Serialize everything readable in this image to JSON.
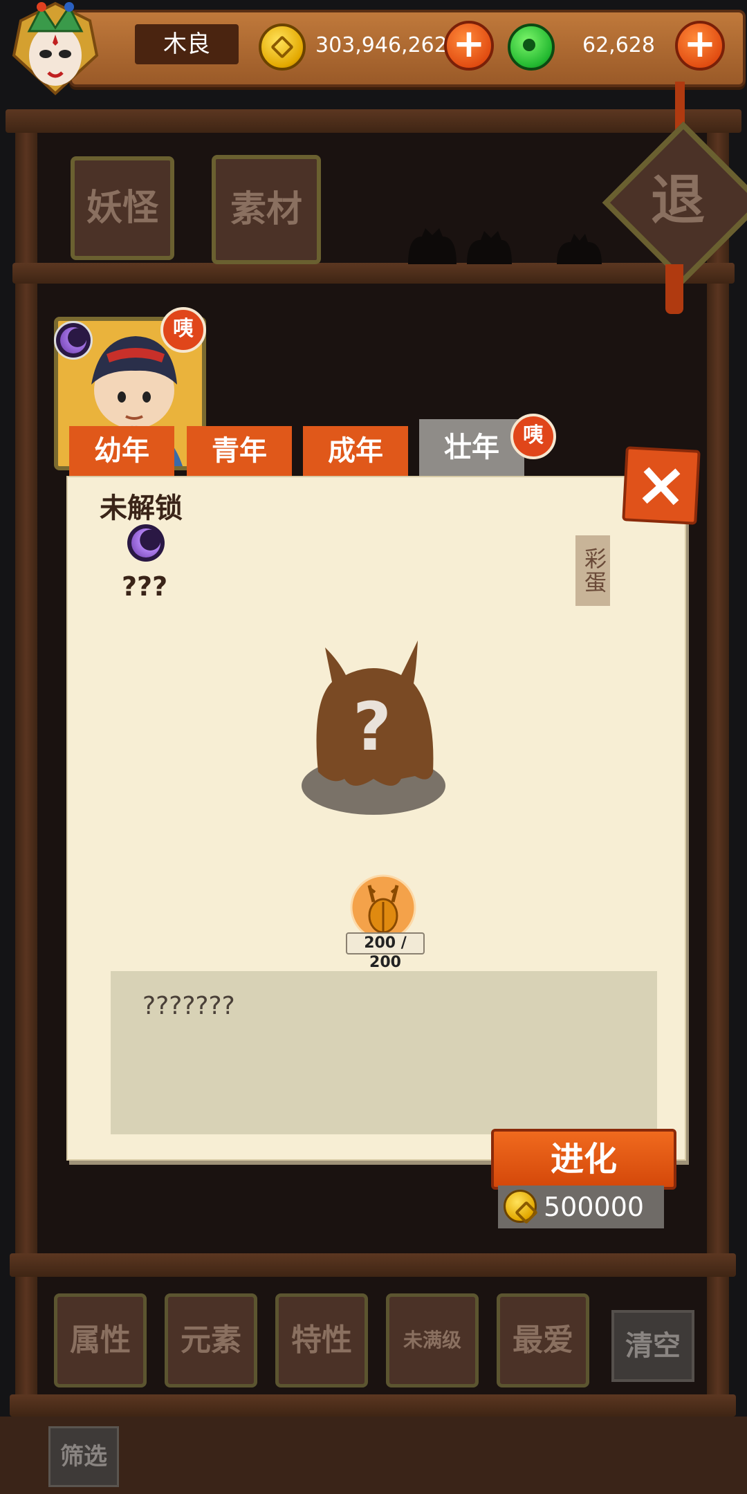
{
  "player": {
    "name": "木良",
    "gold": "303,946,262",
    "jade": "62,628"
  },
  "category_tabs": [
    "妖怪",
    "素材"
  ],
  "exit_label": "退",
  "stage_tabs": [
    "幼年",
    "青年",
    "成年",
    "壮年"
  ],
  "active_stage_index": 3,
  "badge_text": "咦",
  "detail": {
    "status": "未解锁",
    "name": "???",
    "easter_egg": "彩蛋",
    "material_count": "200 / 200",
    "description": "???????"
  },
  "evolve": {
    "label": "进化",
    "cost": "500000"
  },
  "filters": [
    "属性",
    "元素",
    "特性",
    "未满级",
    "最爱",
    "清空"
  ],
  "filter_toggle": "筛选",
  "colors": {
    "accent_orange": "#e0581a",
    "paper": "#f7eed4",
    "wood": "#4b3227"
  }
}
